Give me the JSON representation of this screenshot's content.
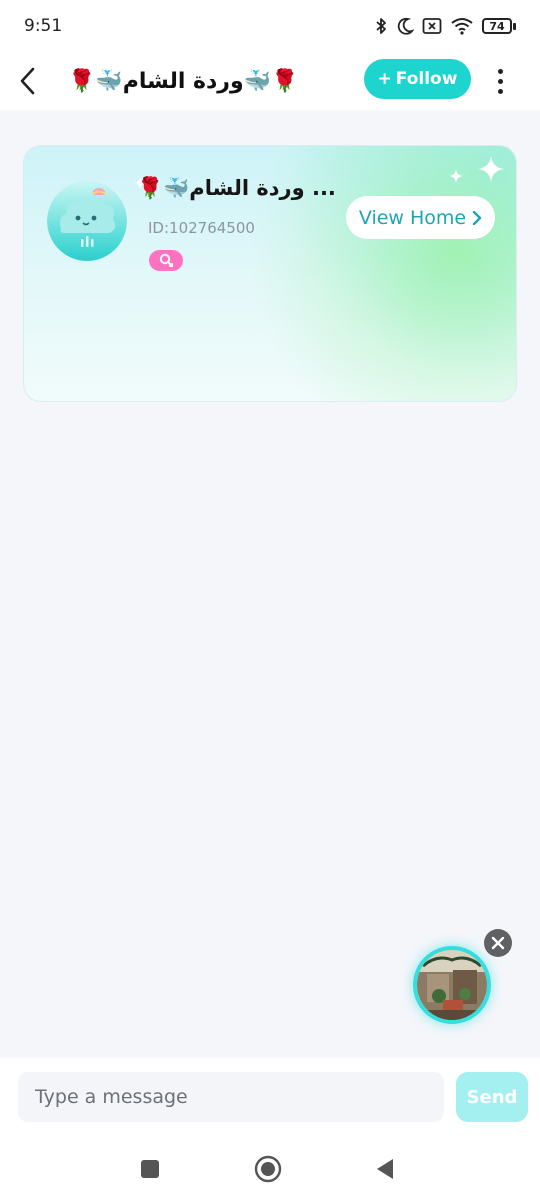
{
  "status_bar": {
    "time": "9:51",
    "battery": "74",
    "icons": [
      "bluetooth-icon",
      "moon-icon",
      "sim-off-icon",
      "wifi-icon",
      "battery-icon"
    ]
  },
  "header": {
    "title": "🌹🐳وردة الشام🐳🌹",
    "follow_label": "Follow",
    "follow_plus": "+",
    "accent_color": "#1ed4cf"
  },
  "profile_card": {
    "name": "🌹🐳وردة الشام ...",
    "id_text": "ID:102764500",
    "view_home_label": "View Home",
    "gender_badge_color": "#ff72c2"
  },
  "composer": {
    "placeholder": "Type a message",
    "send_label": "Send",
    "send_color": "#a4efef"
  },
  "nav": {
    "buttons": [
      "recents-button",
      "home-button",
      "back-button"
    ]
  }
}
